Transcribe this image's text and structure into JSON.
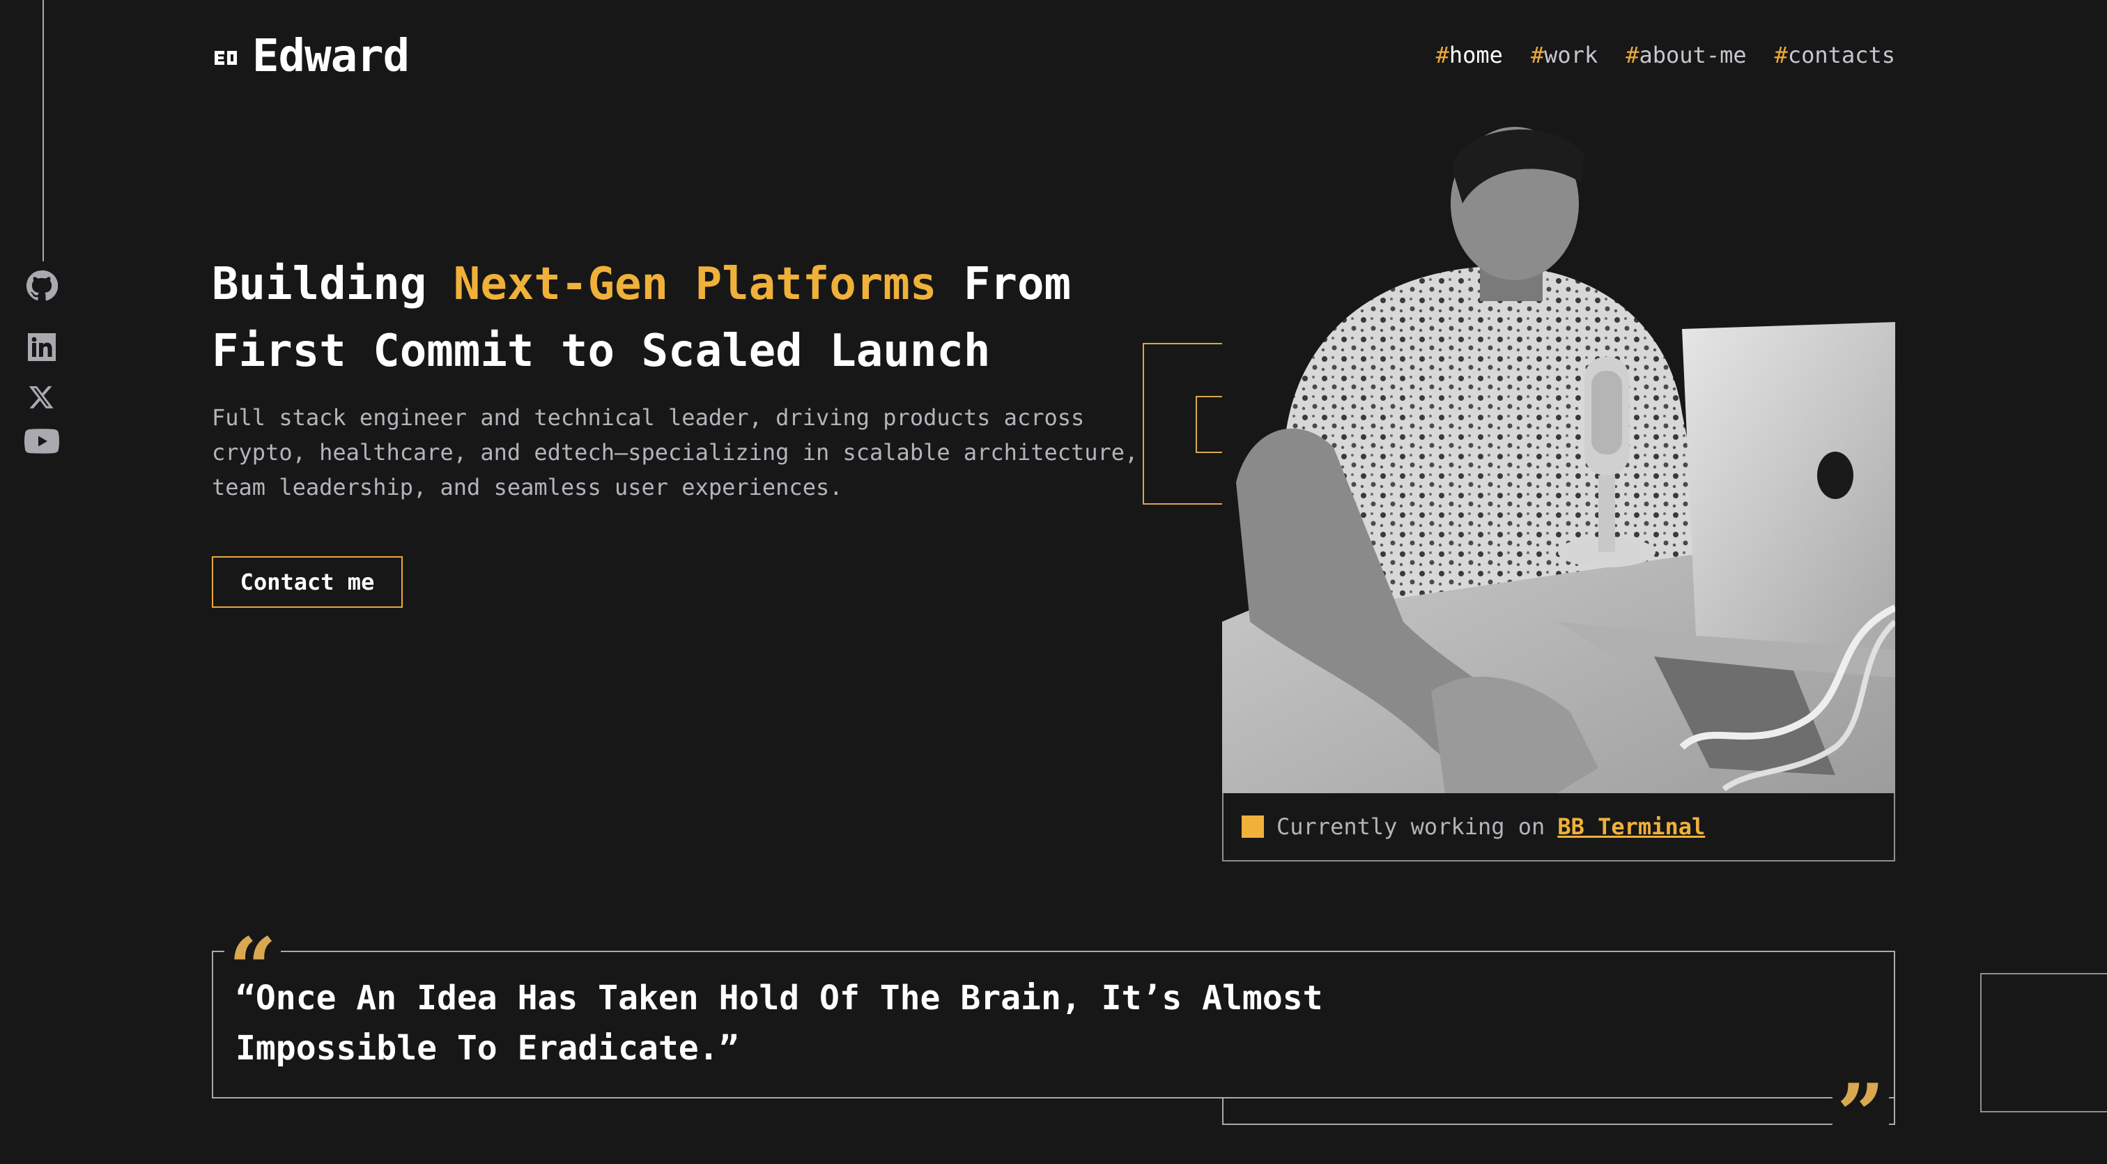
{
  "brand": {
    "name": "Edward"
  },
  "nav": [
    {
      "hash": "#",
      "label": "home",
      "active": true
    },
    {
      "hash": "#",
      "label": "work",
      "active": false
    },
    {
      "hash": "#",
      "label": "about-me",
      "active": false
    },
    {
      "hash": "#",
      "label": "contacts",
      "active": false
    }
  ],
  "social": [
    "github-icon",
    "linkedin-icon",
    "x-icon",
    "youtube-icon"
  ],
  "hero": {
    "headline_pre": "Building ",
    "headline_accent": "Next-Gen Platforms",
    "headline_post": " From First Commit to Scaled Launch",
    "subtitle": "Full stack engineer and technical leader, driving products across crypto, healthcare, and edtech—specializing in scalable architecture, team leadership, and seamless user experiences.",
    "cta": "Contact me"
  },
  "status": {
    "prefix": "Currently working on",
    "project": "BB Terminal"
  },
  "quote": {
    "text": "“Once An Idea Has Taken Hold Of The Brain, It’s Almost Impossible To Eradicate.”"
  },
  "colors": {
    "accent": "#f0b13a",
    "background": "#171718",
    "muted": "#b4b4ba"
  }
}
